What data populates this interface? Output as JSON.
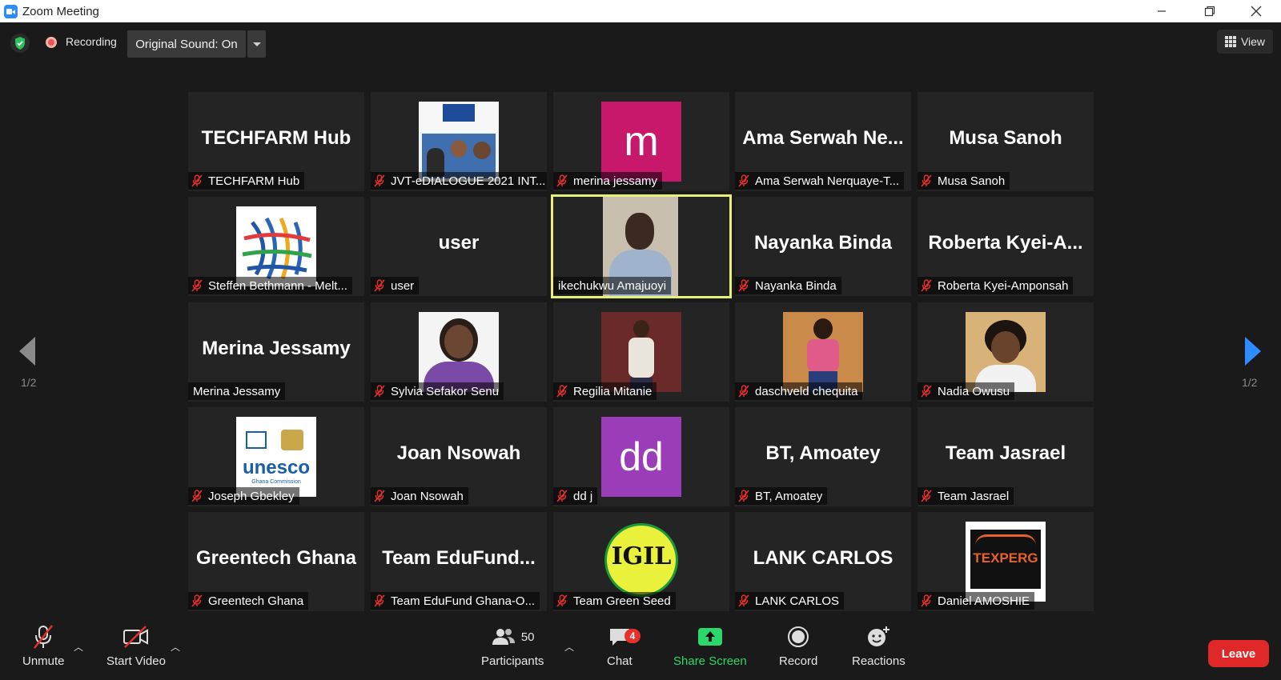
{
  "window": {
    "title": "Zoom Meeting"
  },
  "topbar": {
    "recording_label": "Recording",
    "original_sound_label": "Original Sound: On",
    "view_label": "View"
  },
  "pager": {
    "left": "1/2",
    "right": "1/2"
  },
  "tiles": [
    {
      "display": "TECHFARM Hub",
      "label": "TECHFARM Hub"
    },
    {
      "display": "",
      "label": "JVT-eDIALOGUE 2021 INT..."
    },
    {
      "display": "m",
      "label": "merina jessamy"
    },
    {
      "display": "Ama  Serwah  Ne...",
      "label": "Ama Serwah Nerquaye-T..."
    },
    {
      "display": "Musa Sanoh",
      "label": "Musa Sanoh"
    },
    {
      "display": "",
      "label": "Steffen Bethmann - Melt..."
    },
    {
      "display": "user",
      "label": "user"
    },
    {
      "display": "",
      "label": "ikechukwu Amajuoyi"
    },
    {
      "display": "Nayanka Binda",
      "label": "Nayanka Binda"
    },
    {
      "display": "Roberta  Kyei-A...",
      "label": "Roberta Kyei-Amponsah"
    },
    {
      "display": "Merina Jessamy",
      "label": "Merina Jessamy"
    },
    {
      "display": "",
      "label": "Sylvia Sefakor Senu"
    },
    {
      "display": "",
      "label": "Regilia Mitanie"
    },
    {
      "display": "",
      "label": "daschveld chequita"
    },
    {
      "display": "",
      "label": "Nadia Owusu"
    },
    {
      "display": "",
      "label": "Joseph Gbekley",
      "logo_text": "unesco",
      "logo_sub": "Ghana Commission"
    },
    {
      "display": "Joan Nsowah",
      "label": "Joan Nsowah"
    },
    {
      "display": "dd",
      "label": "dd j"
    },
    {
      "display": "BT, Amoatey",
      "label": "BT, Amoatey"
    },
    {
      "display": "Team Jasrael",
      "label": "Team Jasrael"
    },
    {
      "display": "Greentech Ghana",
      "label": "Greentech Ghana"
    },
    {
      "display": "Team  EduFund...",
      "label": "Team EduFund Ghana-O..."
    },
    {
      "display": "",
      "label": "Team Green Seed",
      "logo_text": "IGIL"
    },
    {
      "display": "LANK CARLOS",
      "label": "LANK CARLOS"
    },
    {
      "display": "",
      "label": "Daniel AMOSHIE",
      "logo_text": "TEXPERG"
    }
  ],
  "toolbar": {
    "unmute": "Unmute",
    "start_video": "Start Video",
    "participants": "Participants",
    "participants_count": "50",
    "chat": "Chat",
    "chat_badge": "4",
    "share_screen": "Share Screen",
    "record": "Record",
    "reactions": "Reactions",
    "leave": "Leave"
  },
  "colors": {
    "accent": "#2d8cff",
    "active_speaker": "#e6ef7a",
    "leave": "#e02828",
    "share": "#2bd96b"
  }
}
